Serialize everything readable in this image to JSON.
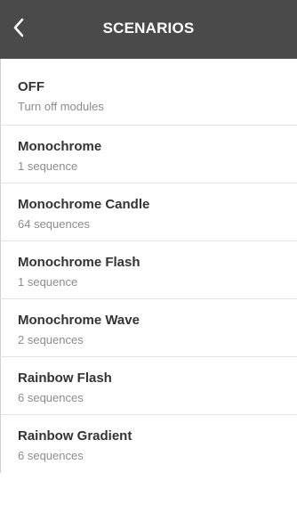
{
  "header": {
    "title": "SCENARIOS",
    "back_icon": "chevron-left-icon",
    "background": "#4a4a4a"
  },
  "scenarios": [
    {
      "title": "OFF",
      "subtitle": "Turn off modules"
    },
    {
      "title": "Monochrome",
      "subtitle": "1 sequence"
    },
    {
      "title": "Monochrome Candle",
      "subtitle": "64 sequences"
    },
    {
      "title": "Monochrome Flash",
      "subtitle": "1 sequence"
    },
    {
      "title": "Monochrome Wave",
      "subtitle": "2 sequences"
    },
    {
      "title": "Rainbow Flash",
      "subtitle": "6 sequences"
    },
    {
      "title": "Rainbow Gradient",
      "subtitle": "6 sequences"
    }
  ]
}
